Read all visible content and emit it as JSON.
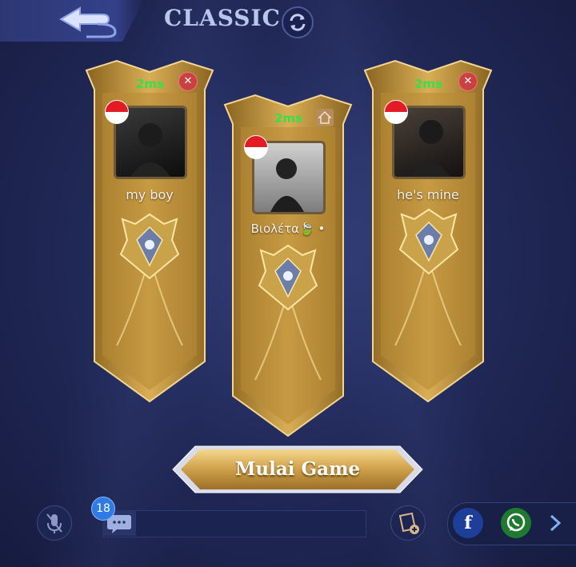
{
  "header": {
    "mode_title": "CLASSIC"
  },
  "players": [
    {
      "ping": "2ms",
      "name": "my boy"
    },
    {
      "ping": "2ms",
      "name": "Βιολέτα🍃 •"
    },
    {
      "ping": "2ms",
      "name": "he's mine"
    }
  ],
  "start_button": {
    "label": "Mulai Game"
  },
  "chat": {
    "unread_count": "18"
  },
  "colors": {
    "banner_gold": "#c89a3a",
    "ping_green": "#35e04a",
    "accent_blue": "#2f7be6"
  }
}
